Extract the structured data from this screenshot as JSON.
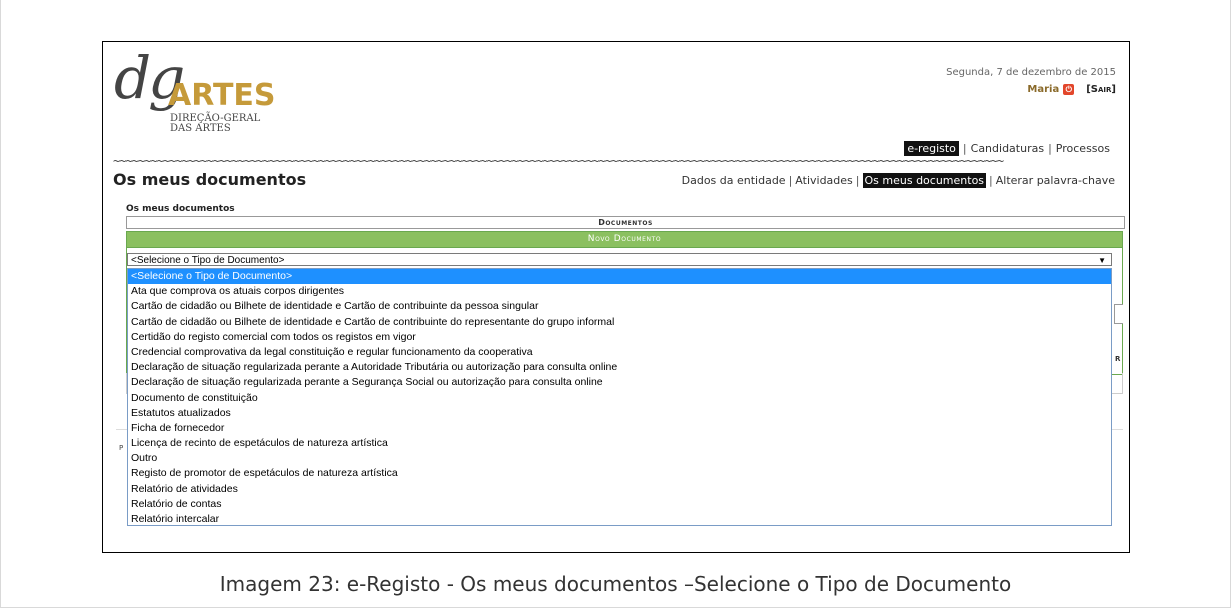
{
  "header": {
    "logo_dg": "dg",
    "logo_artes": "ARTES",
    "logo_sub_1": "DIREÇÃO-GERAL",
    "logo_sub_2": "DAS ARTES",
    "date": "Segunda, 7 de dezembro de 2015",
    "user_name": "Maria",
    "logout_label": "[Sair]"
  },
  "topnav": {
    "items": [
      "e-registo",
      "Candidaturas",
      "Processos"
    ],
    "active": "e-registo",
    "separator": "|"
  },
  "page_title": "Os meus documentos",
  "subnav": {
    "items": [
      "Dados da entidade",
      "Atividades",
      "Os meus documentos",
      "Alterar palavra-chave"
    ],
    "active": "Os meus documentos",
    "separator": "|"
  },
  "section_label": "Os meus documentos",
  "documents_bar": "Documentos",
  "novo_documento": {
    "header": "Novo Documento",
    "select_value": "<Selecione o Tipo de Documento>",
    "options": [
      "<Selecione o Tipo de Documento>",
      "Ata que comprova os atuais corpos dirigentes",
      "Cartão de cidadão ou Bilhete de identidade e Cartão de contribuinte da pessoa singular",
      "Cartão de cidadão ou Bilhete de identidade e Cartão de contribuinte do representante do grupo informal",
      "Certidão do registo comercial com todos os registos em vigor",
      "Credencial comprovativa da legal constituição e regular funcionamento da cooperativa",
      "Declaração de situação regularizada perante a Autoridade Tributária ou autorização para consulta online",
      "Declaração de situação regularizada perante a Segurança Social ou autorização para consulta online",
      "Documento de constituição",
      "Estatutos atualizados",
      "Ficha de fornecedor",
      "Licença de recinto de espetáculos de natureza artística",
      "Outro",
      "Registo de promotor de espetáculos de natureza artística",
      "Relatório de atividades",
      "Relatório de contas",
      "Relatório intercalar"
    ],
    "highlighted_index": 0
  },
  "partial_glyphs": {
    "right_edge": "R",
    "left_edge": "P"
  },
  "caption": "Imagem 23: e-Registo - Os meus documentos –Selecione o Tipo de Documento",
  "colors": {
    "accent_gold": "#c59a3a",
    "green_header": "#8bc060",
    "selection_blue": "#1e90ff"
  }
}
